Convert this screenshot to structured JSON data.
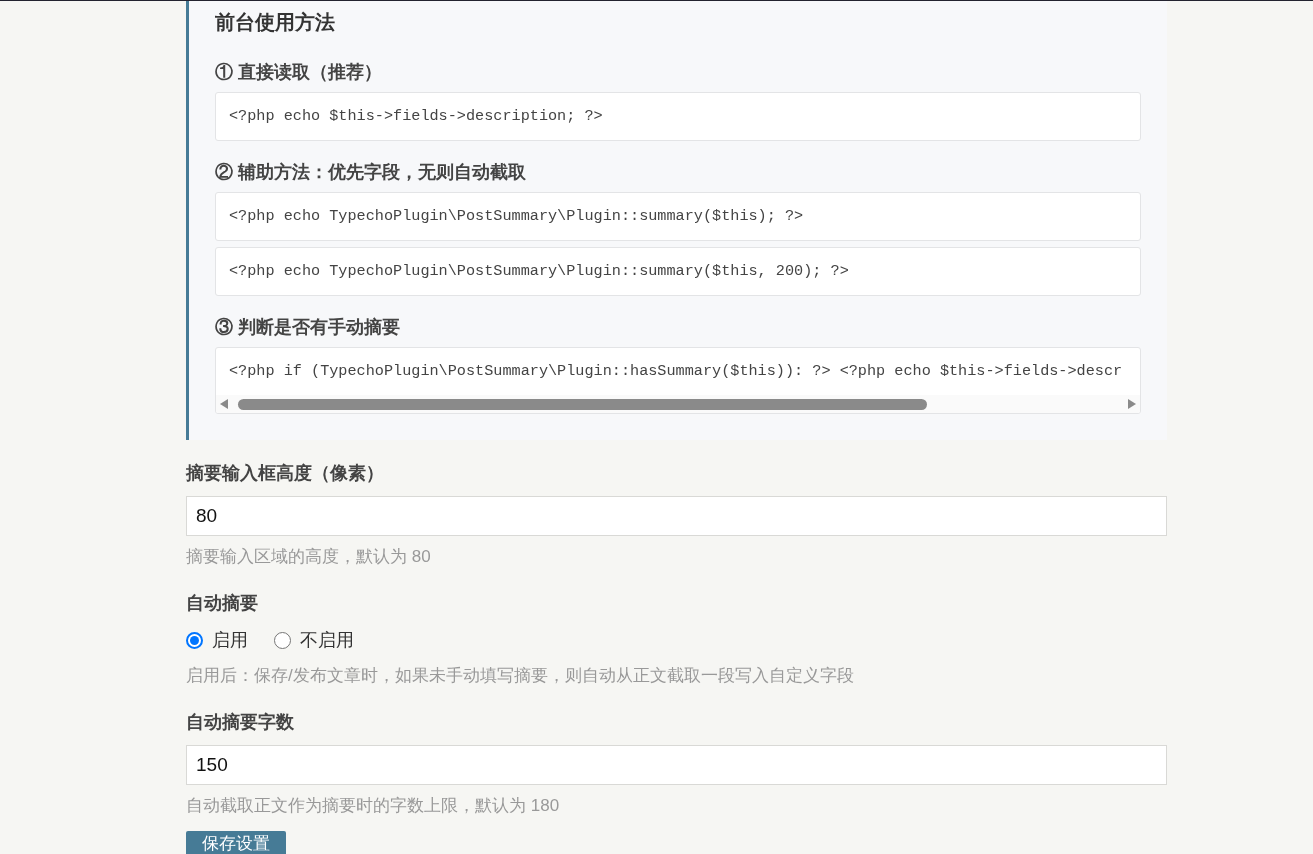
{
  "usage_panel": {
    "title": "前台使用方法",
    "sections": [
      {
        "heading": "① 直接读取（推荐）",
        "code_blocks": [
          {
            "code": "<?php echo $this->fields->description; ?>",
            "scrollbar": false
          }
        ]
      },
      {
        "heading": "② 辅助方法：优先字段，无则自动截取",
        "code_blocks": [
          {
            "code": "<?php echo TypechoPlugin\\PostSummary\\Plugin::summary($this); ?>",
            "scrollbar": false
          },
          {
            "code": "<?php echo TypechoPlugin\\PostSummary\\Plugin::summary($this, 200); ?>",
            "scrollbar": false
          }
        ]
      },
      {
        "heading": "③ 判断是否有手动摘要",
        "code_blocks": [
          {
            "code": "<?php if (TypechoPlugin\\PostSummary\\Plugin::hasSummary($this)): ?> <?php echo $this->fields->descr",
            "scrollbar": true
          }
        ]
      }
    ]
  },
  "settings": [
    {
      "kind": "text",
      "label": "摘要输入框高度（像素）",
      "value": "80",
      "hint": "摘要输入区域的高度，默认为 80"
    },
    {
      "kind": "radio",
      "label": "自动摘要",
      "options": [
        {
          "label": "启用",
          "selected": true
        },
        {
          "label": "不启用",
          "selected": false
        }
      ],
      "hint": "启用后：保存/发布文章时，如果未手动填写摘要，则自动从正文截取一段写入自定义字段"
    },
    {
      "kind": "text",
      "label": "自动摘要字数",
      "value": "150",
      "hint": "自动截取正文作为摘要时的字数上限，默认为 180"
    }
  ],
  "save_button": "保存设置"
}
